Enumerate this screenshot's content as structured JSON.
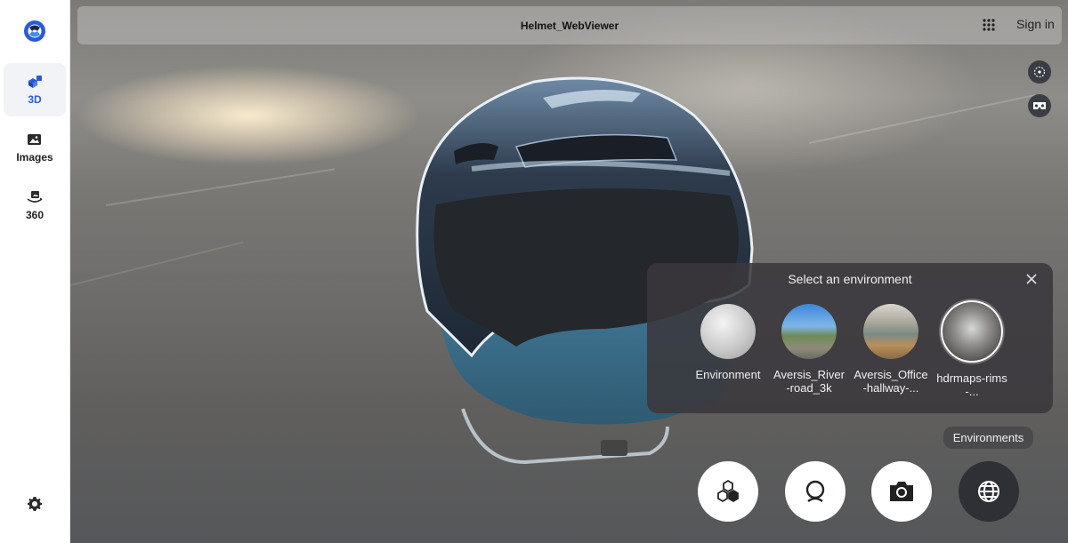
{
  "app": {
    "title": "Helmet_WebViewer",
    "sign_in": "Sign in"
  },
  "sidebar": {
    "items": [
      {
        "label": "3D",
        "icon": "cubes-icon",
        "active": true
      },
      {
        "label": "Images",
        "icon": "image-icon",
        "active": false
      },
      {
        "label": "360",
        "icon": "rotate-360-icon",
        "active": false
      }
    ],
    "settings_icon": "gear-icon"
  },
  "environment_panel": {
    "title": "Select an environment",
    "items": [
      {
        "label": "Environment",
        "selected": false
      },
      {
        "label": "Aversis_River-road_3k",
        "selected": false
      },
      {
        "label": "Aversis_Office-hallway-...",
        "selected": false
      },
      {
        "label": "hdrmaps-rims-...",
        "selected": true
      }
    ]
  },
  "tooltip": {
    "text": "Environments"
  },
  "bottom_toolbar": [
    {
      "name": "model-parts-button",
      "icon": "cubes-icon",
      "active": false
    },
    {
      "name": "materials-button",
      "icon": "material-sphere-icon",
      "active": false
    },
    {
      "name": "screenshot-button",
      "icon": "camera-icon",
      "active": false
    },
    {
      "name": "environments-button",
      "icon": "globe-icon",
      "active": true
    }
  ],
  "colors": {
    "accent": "#2a5bd7",
    "panel": "#3a383c",
    "active_button": "#2f3036"
  }
}
